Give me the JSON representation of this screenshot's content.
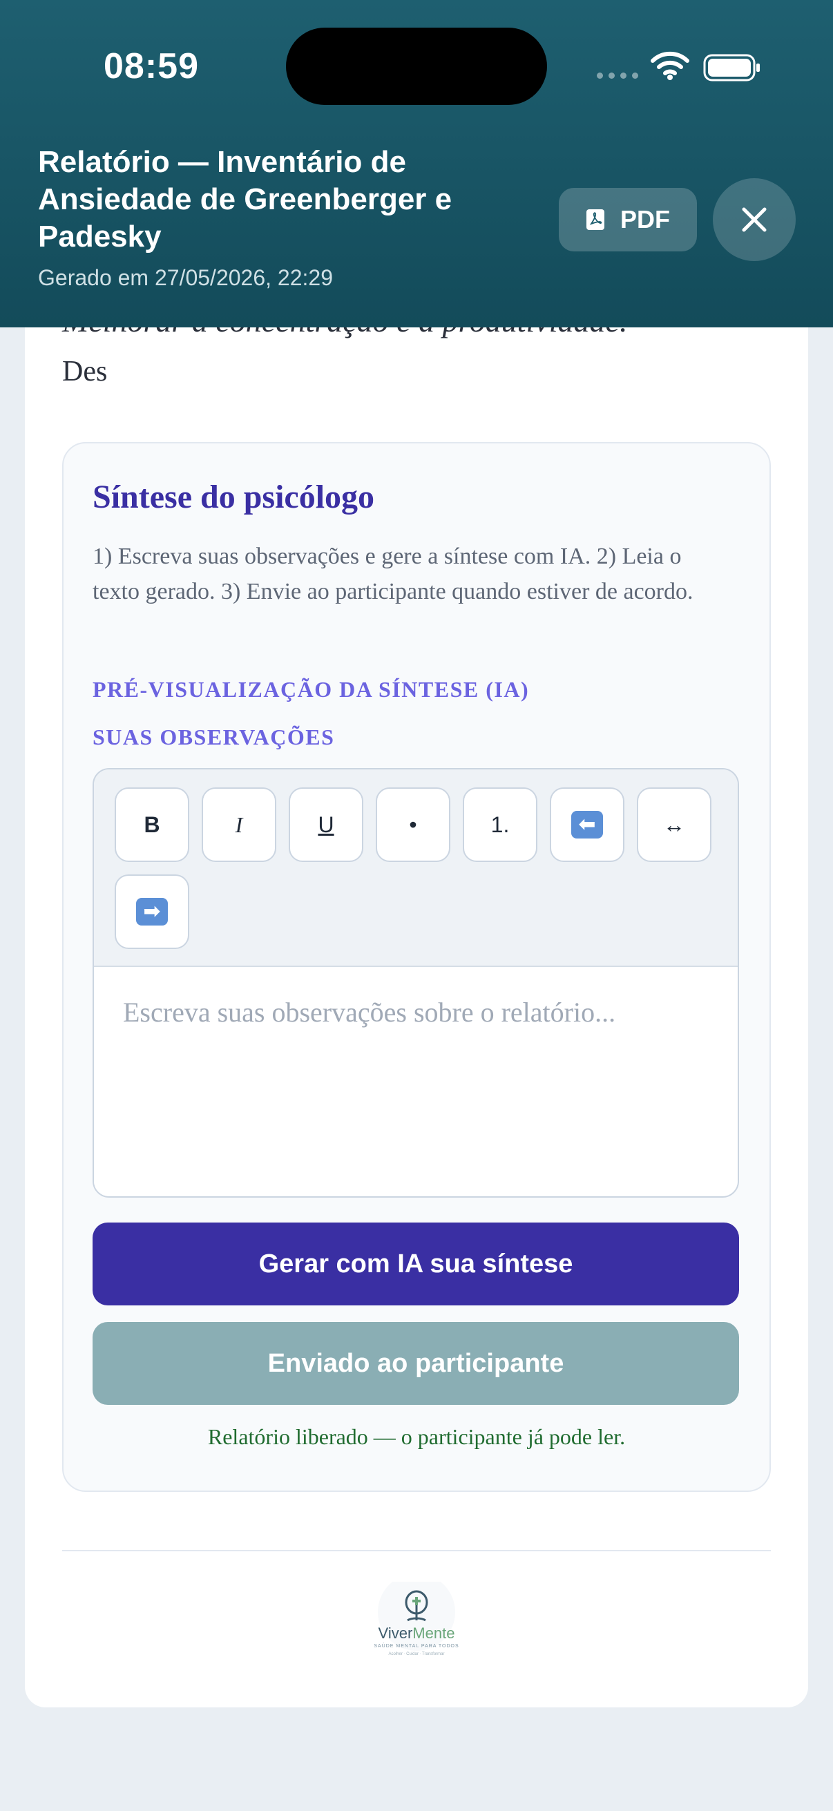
{
  "status_bar": {
    "time": "08:59"
  },
  "header": {
    "title": "Relatório — Inventário de Ansiedade de Greenberger e Padesky",
    "generated": "Gerado em 27/05/2026, 22:29",
    "pdf_label": "PDF",
    "pdf_icon": "pdf-file-icon",
    "close_icon": "close-icon",
    "background_color": "#134b5a"
  },
  "content": {
    "goal_text": "Melhorar a concentração e a produtividade.",
    "truncated_text": "Des"
  },
  "synthesis": {
    "title": "Síntese do psicólogo",
    "instructions": "1) Escreva suas observações e gere a síntese com IA. 2) Leia o texto gerado. 3) Envie ao participante quando estiver de acordo.",
    "preview_label": "PRÉ-VISUALIZAÇÃO DA SÍNTESE (IA)",
    "observations_label": "SUAS OBSERVAÇÕES",
    "toolbar": {
      "bold": "B",
      "italic": "I",
      "underline": "U",
      "bullet": "•",
      "numbered": "1.",
      "outdent_icon": "arrow-left-icon",
      "indent_symbol": "↔",
      "indent_icon": "arrow-right-icon"
    },
    "editor_placeholder": "Escreva suas observações sobre o relatório...",
    "generate_button": "Gerar com IA sua síntese",
    "sent_button": "Enviado ao participante",
    "released_message": "Relatório liberado — o participante já pode ler.",
    "accent_color": "#3a2fa3",
    "sent_color": "#8aaeb4",
    "success_color": "#1f6b2f"
  },
  "footer": {
    "logo_word_a": "Viver",
    "logo_word_b": "Mente",
    "logo_tagline": "SAÚDE MENTAL PARA TODOS",
    "logo_subline": "Acolher · Cuidar · Transformar"
  }
}
